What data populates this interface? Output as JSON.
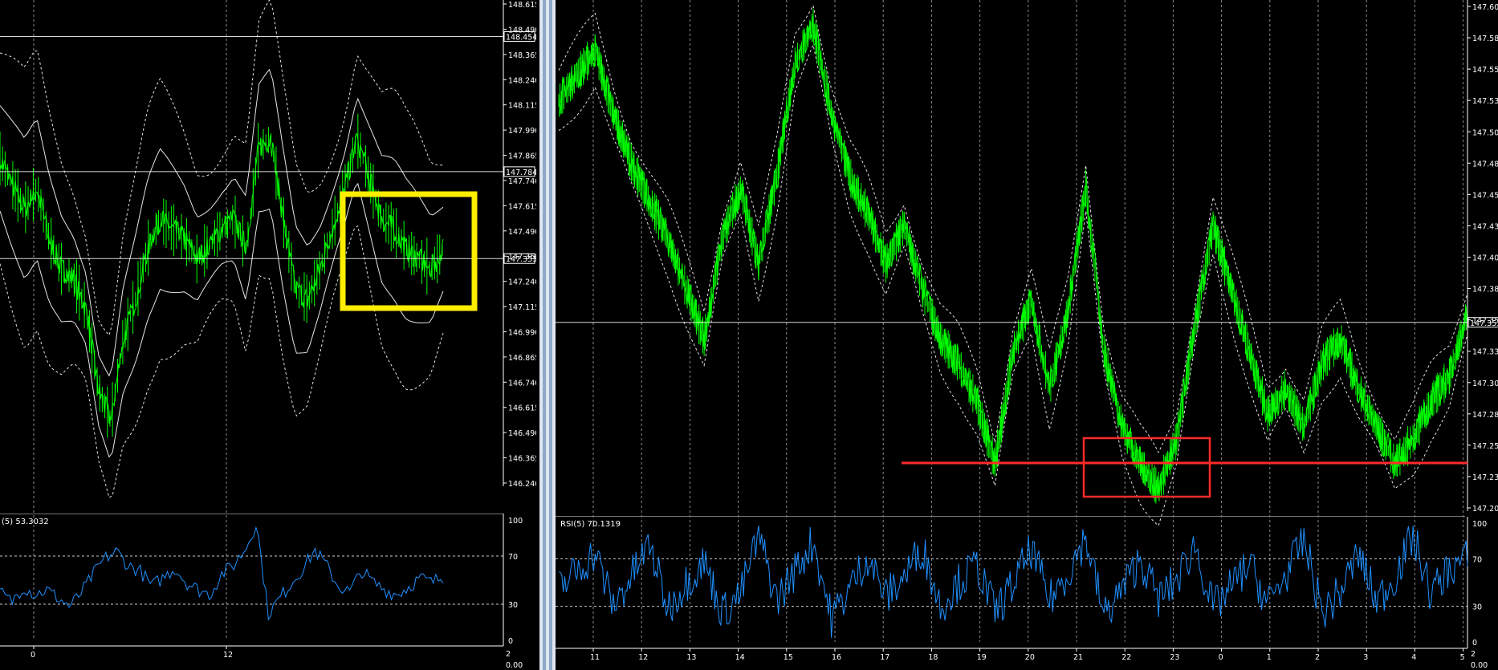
{
  "colors": {
    "background": "#000000",
    "candle": "#00ff00",
    "rsi": "#1e90ff",
    "band": "#ffffff",
    "grid": "#ffffff",
    "highlight_yellow": "#ffee00",
    "support_red": "#ff2a2a",
    "separator": "#8ea9c8"
  },
  "chart_data": [
    {
      "type": "line",
      "panel": "left-price",
      "y_ticks": [
        "148.615",
        "148.490",
        "148.365",
        "148.240",
        "148.115",
        "147.990",
        "147.865",
        "147.740",
        "147.615",
        "147.490",
        "147.365",
        "147.240",
        "147.115",
        "146.990",
        "146.865",
        "146.740",
        "146.615",
        "146.490",
        "146.365",
        "146.240"
      ],
      "ylim": [
        146.24,
        148.615
      ],
      "price_lines": [
        "148.454",
        "147.784",
        "147.353"
      ],
      "x_ticks": [
        "0",
        "12"
      ],
      "series": [
        {
          "values": [
            147.85,
            147.72,
            147.6,
            147.7,
            147.45,
            147.3,
            147.25,
            147.1,
            146.7,
            146.55,
            146.95,
            147.15,
            147.4,
            147.55,
            147.5,
            147.45,
            147.35,
            147.42,
            147.5,
            147.55,
            147.4,
            147.9,
            147.95,
            147.55,
            147.2,
            147.15,
            147.3,
            147.5,
            147.7,
            147.95,
            147.75,
            147.55,
            147.5,
            147.4,
            147.35,
            147.3,
            147.4
          ]
        }
      ]
    },
    {
      "type": "line",
      "panel": "left-rsi",
      "y_ticks": [
        "100",
        "70",
        "30",
        "0"
      ],
      "ylim": [
        0,
        100
      ],
      "label": "(5) 53.3032",
      "series": [
        {
          "values": [
            40,
            32,
            45,
            38,
            42,
            35,
            28,
            40,
            55,
            68,
            74,
            62,
            58,
            45,
            52,
            60,
            48,
            42,
            38,
            55,
            62,
            75,
            98,
            22,
            35,
            48,
            60,
            75,
            62,
            45,
            40,
            58,
            48,
            42,
            38,
            44,
            52,
            48,
            53
          ]
        }
      ]
    },
    {
      "type": "line",
      "panel": "right-price",
      "y_ticks": [
        "147.605",
        "147.580",
        "147.555",
        "147.530",
        "147.505",
        "147.480",
        "147.455",
        "147.430",
        "147.405",
        "147.380",
        "147.355",
        "147.330",
        "147.305",
        "147.280",
        "147.255",
        "147.230",
        "147.205"
      ],
      "ylim": [
        147.205,
        147.605
      ],
      "price_lines": [
        "147.353"
      ],
      "x_ticks": [
        "11",
        "12",
        "13",
        "14",
        "15",
        "16",
        "17",
        "18",
        "19",
        "20",
        "21",
        "22",
        "23",
        "0",
        "1",
        "2",
        "3",
        "4",
        "5"
      ],
      "series": [
        {
          "values": [
            147.53,
            147.55,
            147.57,
            147.52,
            147.48,
            147.45,
            147.42,
            147.38,
            147.34,
            147.42,
            147.46,
            147.4,
            147.47,
            147.56,
            147.59,
            147.52,
            147.47,
            147.44,
            147.4,
            147.43,
            147.38,
            147.34,
            147.32,
            147.29,
            147.24,
            147.33,
            147.37,
            147.3,
            147.36,
            147.46,
            147.33,
            147.27,
            147.24,
            147.22,
            147.26,
            147.35,
            147.43,
            147.38,
            147.33,
            147.28,
            147.3,
            147.27,
            147.32,
            147.34,
            147.3,
            147.27,
            147.24,
            147.26,
            147.29,
            147.31,
            147.36
          ]
        }
      ]
    },
    {
      "type": "line",
      "panel": "right-rsi",
      "y_ticks": [
        "100",
        "70",
        "30",
        "0"
      ],
      "ylim": [
        0,
        100
      ],
      "label": "RSI(5) 70.1319",
      "series": [
        {
          "values": [
            45,
            60,
            75,
            30,
            55,
            82,
            28,
            50,
            68,
            25,
            40,
            90,
            35,
            60,
            85,
            20,
            45,
            72,
            38,
            55,
            80,
            30,
            50,
            65,
            25,
            48,
            78,
            35,
            58,
            88,
            22,
            44,
            70,
            36,
            52,
            82,
            28,
            46,
            66,
            32,
            56,
            86,
            24,
            42,
            74,
            34,
            54,
            90,
            40,
            62,
            70
          ]
        }
      ]
    }
  ],
  "overlays": {
    "left_axis_extra": "2",
    "left_axis_extra2": "0.00",
    "right_axis_extra": "2",
    "right_axis_extra2": "0.00"
  }
}
